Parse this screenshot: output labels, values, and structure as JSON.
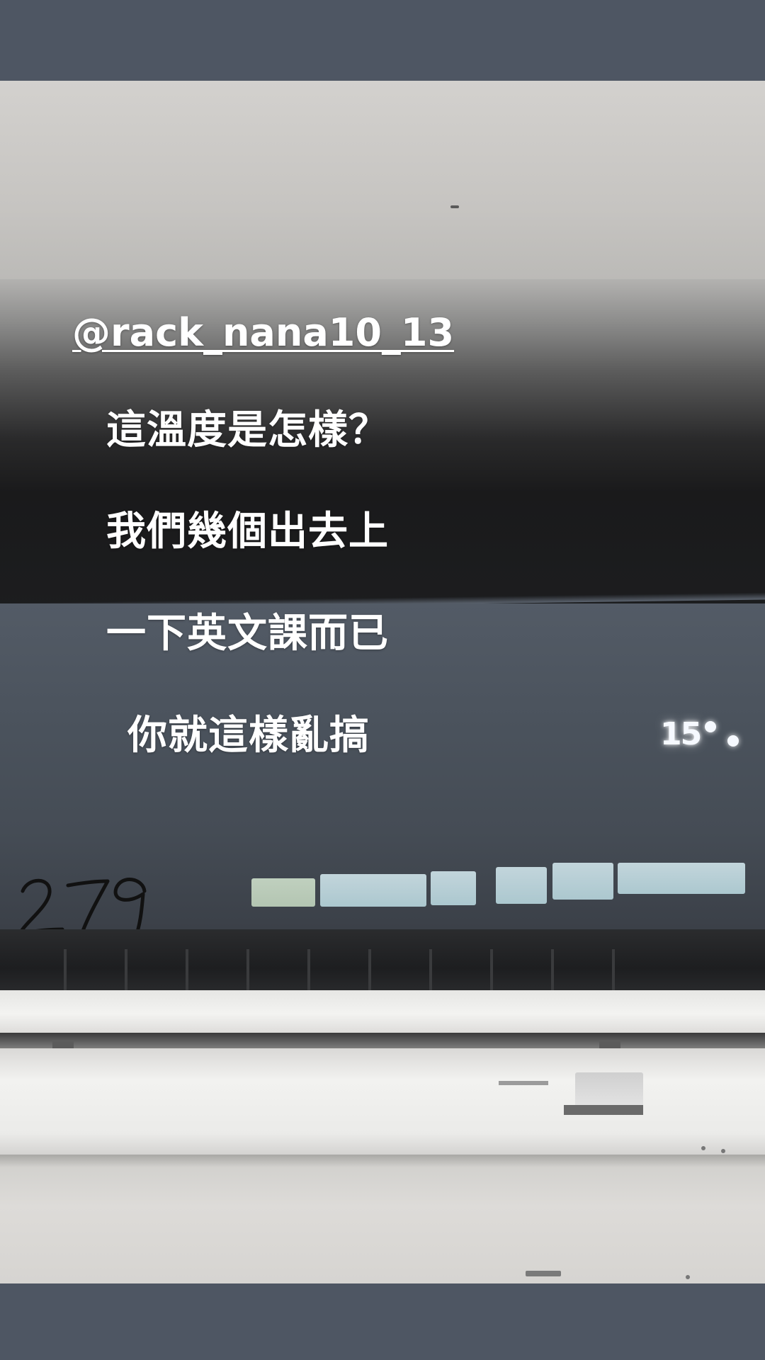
{
  "story": {
    "mention": "@rack_nana10_13",
    "caption_lines": [
      "這溫度是怎樣？",
      "我們幾個出去上",
      "一下英文課而已",
      "你就這樣亂搞"
    ]
  },
  "photo": {
    "ac_display": {
      "value": "15"
    },
    "handwritten_number": "279"
  },
  "colors": {
    "letterbox": "#4e5663",
    "overlay_text": "#ffffff",
    "display_glow": "#f6f9ff"
  }
}
